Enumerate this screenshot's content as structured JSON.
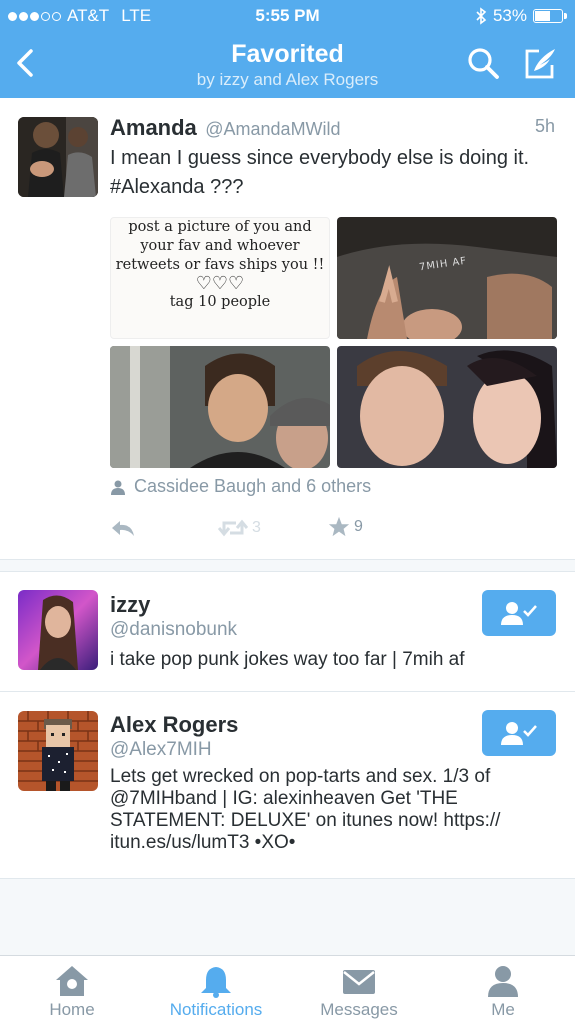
{
  "status_bar": {
    "carrier": "AT&T",
    "network": "LTE",
    "time": "5:55 PM",
    "battery": "53%",
    "battery_level": 0.53
  },
  "header": {
    "title": "Favorited",
    "subtitle": "by izzy and Alex Rogers"
  },
  "tweet": {
    "name": "Amanda",
    "handle": "@AmandaMWild",
    "time": "5h",
    "text": "I mean I guess since everybody else is doing it. #Alexanda ???",
    "meme_lines": [
      "post a picture of you and",
      "your fav and whoever",
      "retweets or favs ships you !!",
      "♡♡♡",
      "tag 10 people"
    ],
    "shirt_text": "7MIH AF",
    "social_context": "Cassidee Baugh and 6 others",
    "retweets": "3",
    "favorites": "9"
  },
  "users": [
    {
      "name": "izzy",
      "handle": "@danisnobunk",
      "bio": "i take pop punk jokes way too far | 7mih af"
    },
    {
      "name": "Alex Rogers",
      "handle": "@Alex7MIH",
      "bio_lines": [
        "Lets get wrecked on pop-tarts and sex. 1/3 of",
        "@7MIHband | IG: alexinheaven Get 'THE",
        "STATEMENT: DELUXE' on itunes now! https://",
        "itun.es/us/lumT3 •XO•"
      ]
    }
  ],
  "tabs": [
    {
      "label": "Home",
      "icon": "home-icon"
    },
    {
      "label": "Notifications",
      "icon": "bell-icon"
    },
    {
      "label": "Messages",
      "icon": "envelope-icon"
    },
    {
      "label": "Me",
      "icon": "person-icon"
    }
  ],
  "colors": {
    "brand": "#55acee",
    "text": "#292f33",
    "muted": "#8899a6"
  }
}
